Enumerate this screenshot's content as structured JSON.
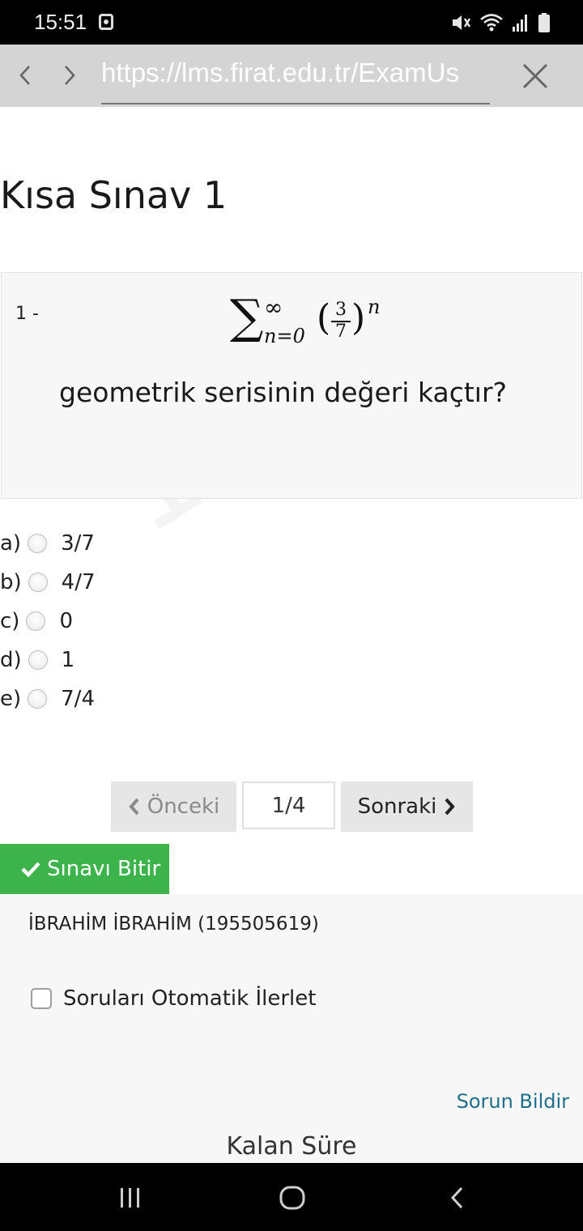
{
  "status_bar": {
    "time": "15:51"
  },
  "browser": {
    "url": "https://lms.firat.edu.tr/ExamUs"
  },
  "page": {
    "title": "Kısa Sınav 1"
  },
  "question": {
    "number": "1 -",
    "formula": {
      "upper_limit": "∞",
      "lower_limit": "n=0",
      "numerator": "3",
      "denominator": "7",
      "exponent": "n"
    },
    "text": "geometrik serisinin değeri kaçtır?"
  },
  "watermark": "19550",
  "options": [
    {
      "letter": "a)",
      "value": "3/7"
    },
    {
      "letter": "b)",
      "value": "4/7"
    },
    {
      "letter": "c)",
      "value": "0"
    },
    {
      "letter": "d)",
      "value": "1"
    },
    {
      "letter": "e)",
      "value": "7/4"
    }
  ],
  "pager": {
    "prev_label": "Önceki",
    "indicator": "1/4",
    "next_label": "Sonraki"
  },
  "finish_label": "Sınavı Bitir",
  "student": "İBRAHİM İBRAHİM (195505619)",
  "auto_advance_label": "Soruları Otomatik İlerlet",
  "report_label": "Sorun Bildir",
  "remaining_label": "Kalan Süre",
  "colors": {
    "finish_button": "#3cb44b",
    "link": "#1f6f8b",
    "browser_bar": "#d4d4d4"
  }
}
